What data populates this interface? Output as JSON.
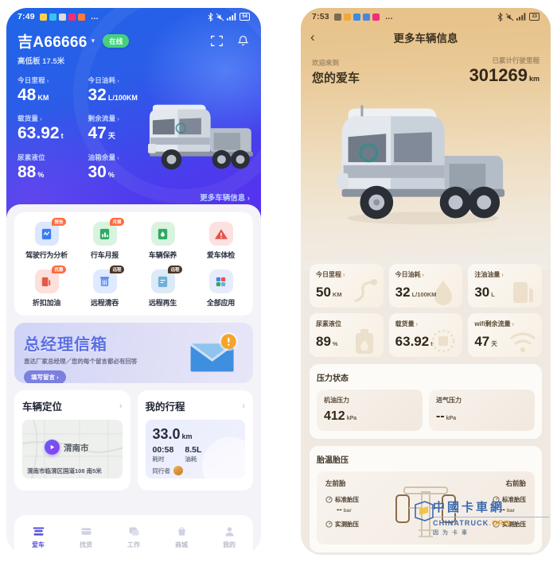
{
  "colors": {
    "blue_primary": "#2b5ce8",
    "purple": "#5a2ff0",
    "accent_green": "#46d07e",
    "beige": "#e7c188",
    "tab_active": "#5a55e0"
  },
  "left_phone": {
    "statusbar": {
      "time": "7:49",
      "icons": [
        "app-icon",
        "clock-icon",
        "card-icon",
        "gallery-icon",
        "app-icon"
      ],
      "overflow": "…",
      "bluetooth": "bluetooth-icon",
      "mute": "mute-icon",
      "signal": "signal-icon",
      "battery": "54"
    },
    "header": {
      "plate": "吉A66666",
      "caret": "▾",
      "status_badge": "在线",
      "scan_icon": "scan-icon",
      "bell_icon": "bell-icon",
      "model": "高低板 17.5米",
      "more_info": "更多车辆信息 ›",
      "stats": [
        {
          "label": "今日里程",
          "arrow": "›",
          "value": "48",
          "unit": "KM"
        },
        {
          "label": "今日油耗",
          "arrow": "›",
          "value": "32",
          "unit": "L/100KM"
        },
        {
          "label": "载货量",
          "arrow": "›",
          "value": "63.92",
          "unit": "t"
        },
        {
          "label": "剩余流量",
          "arrow": "›",
          "value": "47",
          "unit": "天"
        },
        {
          "label": "尿素液位",
          "arrow": "",
          "value": "88",
          "unit": "%"
        },
        {
          "label": "油箱余量",
          "arrow": "›",
          "value": "30",
          "unit": "%"
        }
      ]
    },
    "apps": [
      {
        "label": "驾驶行为分析",
        "tag": "报告",
        "icon": "analysis-icon",
        "color": "#dbe7ff",
        "fg": "#3b7bf0"
      },
      {
        "label": "行车月报",
        "tag": "月报",
        "icon": "report-icon",
        "color": "#d9f3e0",
        "fg": "#2faa63"
      },
      {
        "label": "车辆保养",
        "tag": "",
        "icon": "maintenance-icon",
        "color": "#d9f3e0",
        "fg": "#2faa63"
      },
      {
        "label": "爱车体检",
        "tag": "",
        "icon": "warning-icon",
        "color": "#fde0e0",
        "fg": "#e0554d"
      },
      {
        "label": "折扣加油",
        "tag": "优惠",
        "icon": "fuel-icon",
        "color": "#fde0dc",
        "fg": "#e2594a"
      },
      {
        "label": "远程清吞",
        "tag": "远程",
        "icon": "clean-icon",
        "color": "#dfe9ff",
        "fg": "#4f7fe8"
      },
      {
        "label": "远程再生",
        "tag": "远程",
        "icon": "regen-icon",
        "color": "#dceaf6",
        "fg": "#3f8fc4"
      },
      {
        "label": "全部应用",
        "tag": "",
        "icon": "grid-icon",
        "color": "#e6ecfb",
        "fg": "#4f7fe8"
      }
    ],
    "gm_banner": {
      "title": "总经理信箱",
      "subtitle": "直达厂家总经理／您的每个留言都必有回答",
      "button": "填写留言 ›",
      "icon": "mail-alert-icon"
    },
    "location_card": {
      "title": "车辆定位",
      "arrow": "›",
      "city": "渭南市",
      "address": "渭南市临渭区国道108\n南5米",
      "pin_icon": "location-pin-icon"
    },
    "trip_card": {
      "title": "我的行程",
      "arrow": "›",
      "distance": "33.0",
      "distance_unit": "km",
      "duration": "00:58",
      "duration_label": "耗时",
      "fuel": "8.5L",
      "fuel_label": "油耗",
      "companion_label": "同行者",
      "avatar": "avatar-icon"
    },
    "tabs": [
      {
        "label": "爱车",
        "icon": "truck-icon",
        "active": true
      },
      {
        "label": "找货",
        "icon": "box-icon",
        "active": false
      },
      {
        "label": "工作",
        "icon": "work-icon",
        "active": false
      },
      {
        "label": "商城",
        "icon": "shop-icon",
        "active": false
      },
      {
        "label": "我的",
        "icon": "person-icon",
        "active": false
      }
    ]
  },
  "right_phone": {
    "statusbar": {
      "time": "7:53",
      "overflow": "…",
      "battery": "33"
    },
    "nav": {
      "back": "‹",
      "title": "更多车辆信息"
    },
    "welcome": {
      "small": "欢迎来到",
      "big": "您的爱车",
      "odo_label": "已累计行驶里程",
      "odo_value": "301269",
      "odo_unit": "km"
    },
    "cards": [
      {
        "label": "今日里程",
        "arrow": "›",
        "value": "50",
        "unit": "KM",
        "icon": "route-icon"
      },
      {
        "label": "今日油耗",
        "arrow": "›",
        "value": "32",
        "unit": "L/100KM",
        "icon": "fuel-drop-icon"
      },
      {
        "label": "注油油量",
        "arrow": "›",
        "value": "30",
        "unit": "L",
        "icon": "pump-icon"
      },
      {
        "label": "尿素液位",
        "arrow": "",
        "value": "89",
        "unit": "%",
        "icon": "urea-can-icon"
      },
      {
        "label": "载货量",
        "arrow": "›",
        "value": "63.92",
        "unit": "t",
        "icon": "cargo-icon"
      },
      {
        "label": "wifi剩余流量",
        "arrow": "›",
        "value": "47",
        "unit": "天",
        "icon": "wifi-icon"
      }
    ],
    "pressure": {
      "title": "压力状态",
      "items": [
        {
          "label": "机油压力",
          "value": "412",
          "unit": "kPa"
        },
        {
          "label": "进气压力",
          "value": "--",
          "unit": "kPa"
        }
      ]
    },
    "tires": {
      "title": "胎温胎压",
      "left_title": "左前胎",
      "right_title": "右前胎",
      "rows": [
        {
          "label": "标准胎压",
          "value": "--",
          "unit": "bar"
        },
        {
          "label": "实测胎压",
          "value": "--",
          "unit": "bar"
        }
      ]
    }
  },
  "watermark": {
    "cn": "中國卡車網",
    "en_main": "CHINATRUCK",
    "en_dot": ".",
    "en_org": "ORG",
    "sub": "因为卡車"
  }
}
